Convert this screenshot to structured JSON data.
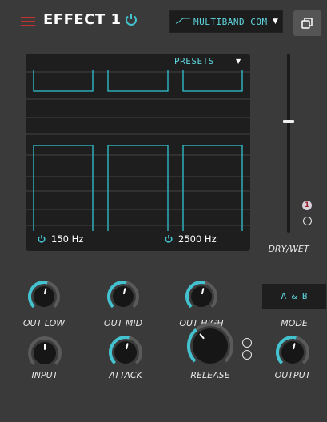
{
  "header": {
    "title": "EFFECT 1",
    "preset_name": "MULTIBAND COM",
    "accent": "#43c3d0",
    "menu_color": "#c0322b"
  },
  "display": {
    "presets_label": "PRESETS",
    "low_crossover": "150 Hz",
    "high_crossover": "2500 Hz"
  },
  "drywet": {
    "label": "DRY/WET",
    "level": 0.62,
    "badge": "1"
  },
  "row1": [
    {
      "label": "OUT LOW",
      "value": 0.55
    },
    {
      "label": "OUT MID",
      "value": 0.55
    },
    {
      "label": "OUT HIGH",
      "value": 0.55
    }
  ],
  "mode": {
    "label": "MODE",
    "value": "A & B"
  },
  "row2": [
    {
      "label": "INPUT",
      "value": 0.5
    },
    {
      "label": "ATTACK",
      "value": 0.55
    },
    {
      "label": "RELEASE",
      "value": 0.35
    },
    {
      "label": "OUTPUT",
      "value": 0.55
    }
  ]
}
